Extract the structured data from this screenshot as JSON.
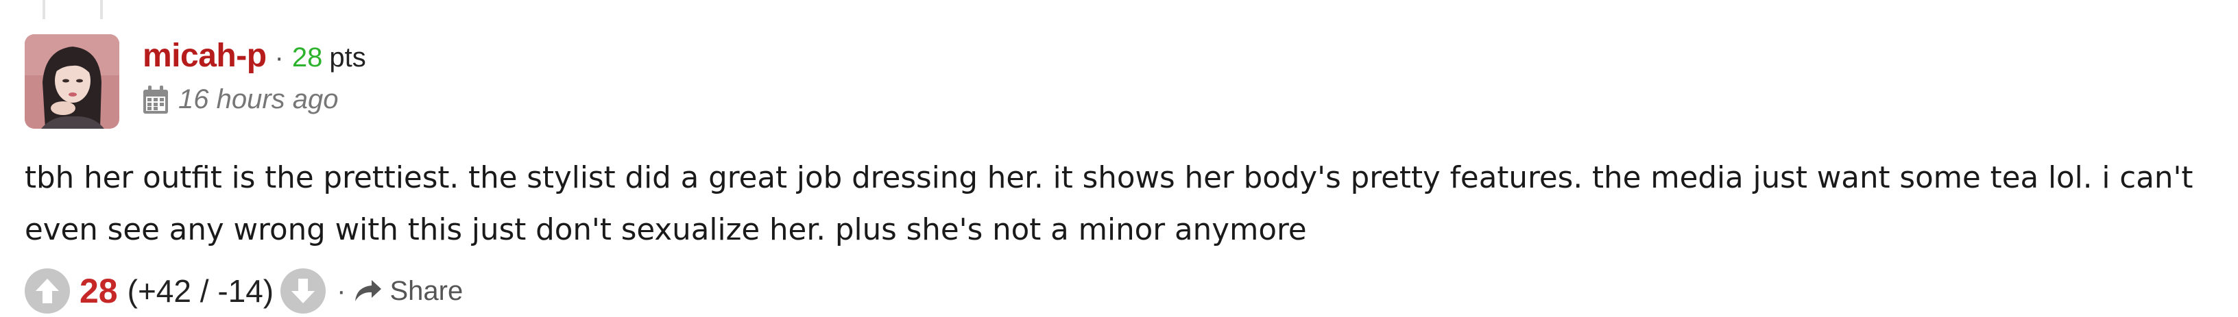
{
  "comment": {
    "username": "micah-p",
    "meta_separator": "·",
    "points": "28",
    "points_label": "pts",
    "timestamp": "16 hours ago",
    "body": "tbh her outfit is the prettiest. the stylist did a great job dressing her. it shows her body's pretty features. the media just want some tea lol. i can't even see any wrong with this just don't sexualize her. plus she's not a minor anymore",
    "score": "28",
    "vote_breakdown": "(+42 / -14)",
    "action_separator": "·",
    "share_label": "Share"
  },
  "icons": {
    "upvote": "arrow-up-circle-icon",
    "downvote": "arrow-down-circle-icon",
    "timestamp": "calendar-icon",
    "share": "share-arrow-icon"
  },
  "colors": {
    "username": "#b71c1c",
    "points": "#2db32d",
    "score": "#c62828",
    "vote_button": "#c6c6c6",
    "muted": "#777777"
  }
}
